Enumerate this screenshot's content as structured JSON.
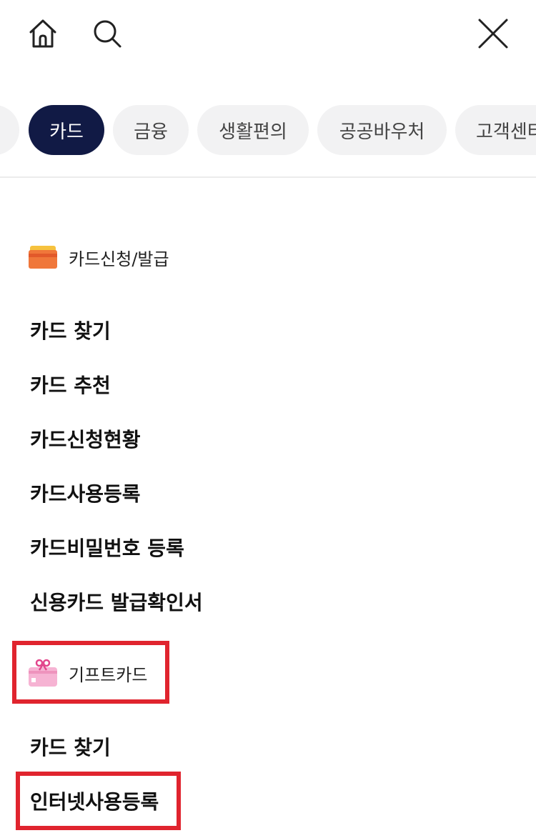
{
  "header": {
    "home_icon": "home-icon",
    "search_icon": "search-icon",
    "close_icon": "close-icon"
  },
  "tabs": [
    {
      "label": ""
    },
    {
      "label": "카드",
      "active": true
    },
    {
      "label": "금융"
    },
    {
      "label": "생활편의"
    },
    {
      "label": "공공바우처"
    },
    {
      "label": "고객센터"
    }
  ],
  "sections": [
    {
      "title": "카드신청/발급",
      "icon": "card-icon",
      "items": [
        "카드 찾기",
        "카드 추천",
        "카드신청현황",
        "카드사용등록",
        "카드비밀번호 등록",
        "신용카드 발급확인서"
      ]
    },
    {
      "title": "기프트카드",
      "icon": "gift-card-icon",
      "items": [
        "카드 찾기",
        "인터넷사용등록"
      ]
    }
  ],
  "colors": {
    "active_tab": "#111a45",
    "tab_bg": "#f2f2f3",
    "highlight": "#e0242e"
  }
}
